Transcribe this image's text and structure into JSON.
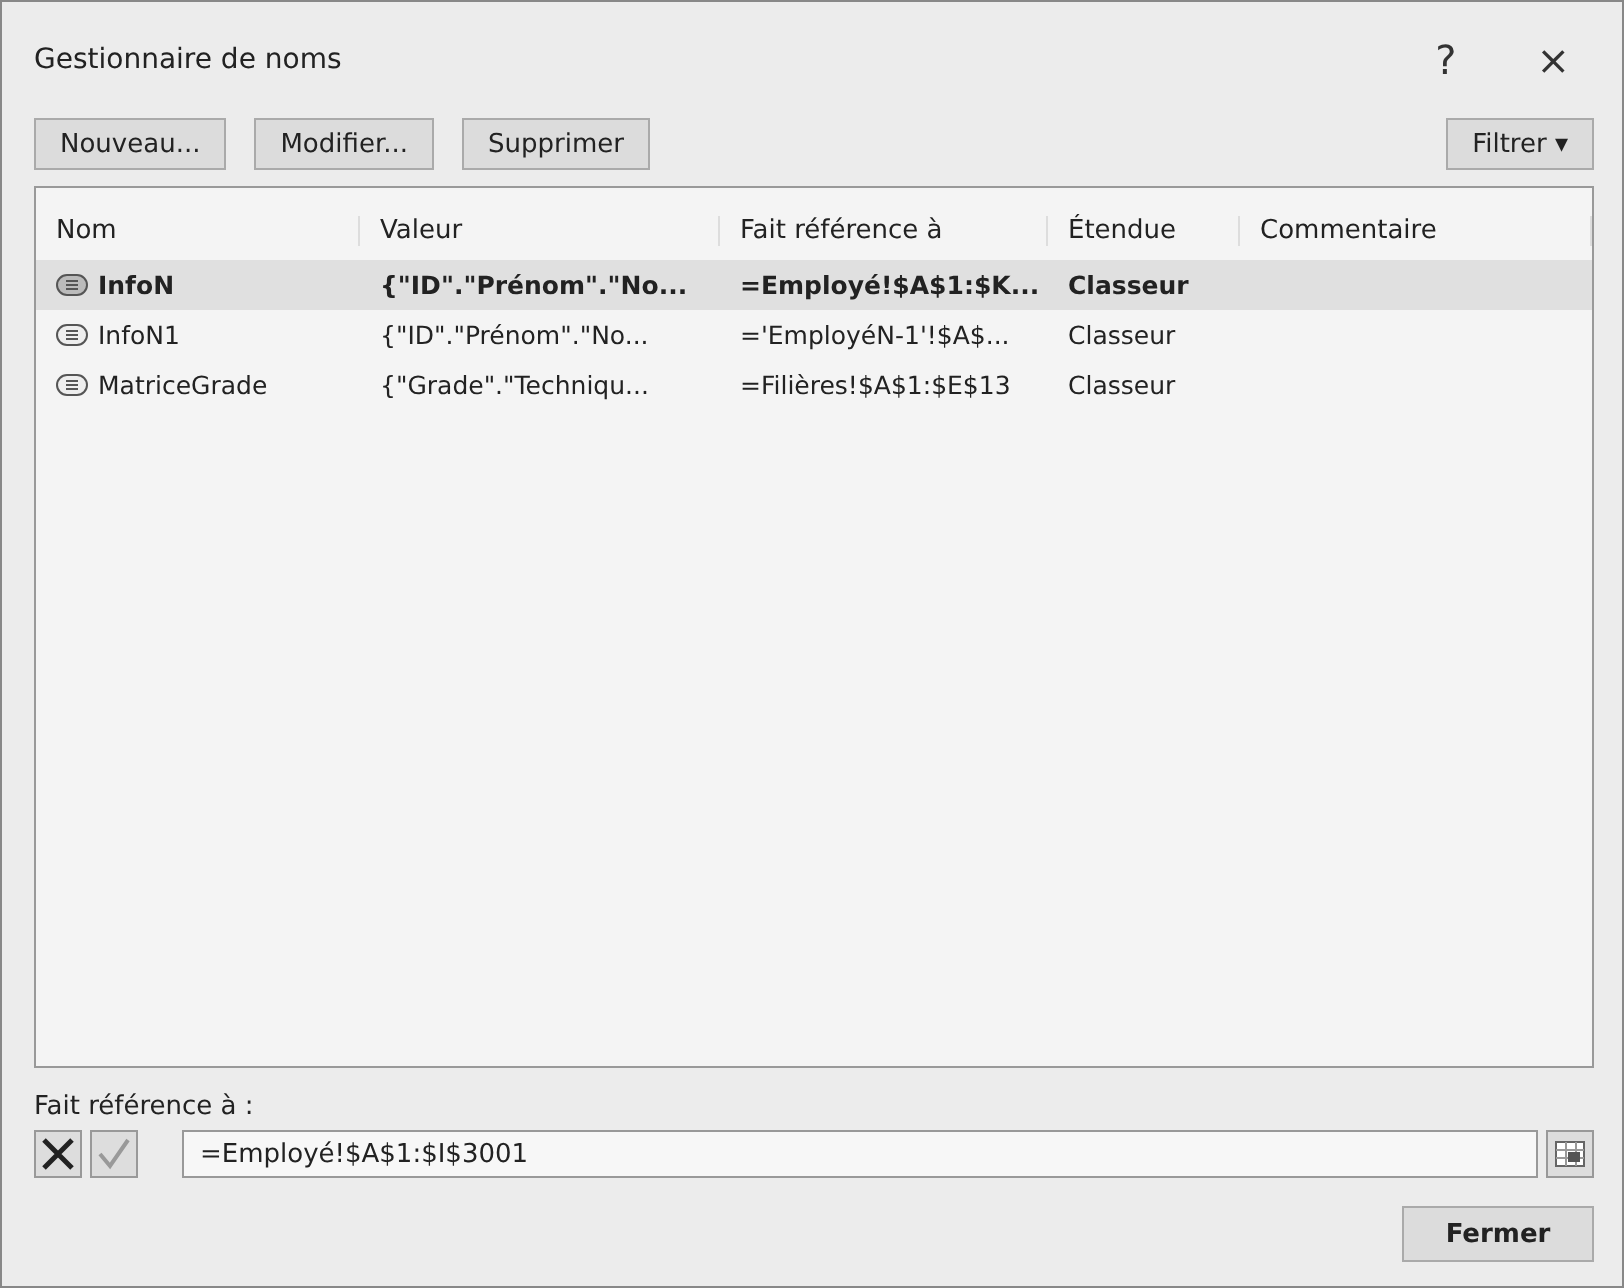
{
  "window": {
    "title": "Gestionnaire de noms",
    "help": "?",
    "close": "×"
  },
  "toolbar": [
    {
      "label": "Nouveau..."
    },
    {
      "label": "Modifier..."
    },
    {
      "label": "Supprimer"
    }
  ],
  "filter_button": {
    "label": "Filtrer",
    "caret": "▾"
  },
  "table": {
    "columns": [
      "Nom",
      "Valeur",
      "Fait référence à",
      "Étendue",
      "Commentaire"
    ],
    "rows": [
      {
        "name": "InfoN",
        "value": "{\"ID\".\"Prénom\".\"No...",
        "refers_to": "=Employé!$A$1:$K...",
        "scope": "Classeur",
        "selected": true
      },
      {
        "name": "InfoN1",
        "value": "{\"ID\".\"Prénom\".\"No...",
        "refers_to": "='EmployéN-1'!$A$...",
        "scope": "Classeur",
        "selected": false
      },
      {
        "name": "MatriceGrade",
        "value": "{\"Grade\".\"Techniqu...",
        "refers_to": "=Filières!$A$1:$E$13",
        "scope": "Classeur",
        "selected": false
      }
    ]
  },
  "refers_to": {
    "label": "Fait référence à :",
    "value": "=Employé!$A$1:$I$3001"
  },
  "buttons": [
    "Fermer"
  ]
}
